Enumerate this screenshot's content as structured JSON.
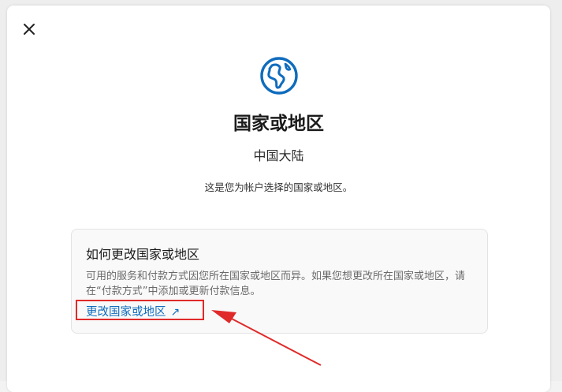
{
  "dialog": {
    "close_icon": "close-icon",
    "globe_icon": "globe-icon",
    "title": "国家或地区",
    "current_region": "中国大陆",
    "description": "这是您为帐户选择的国家或地区。"
  },
  "info_card": {
    "title": "如何更改国家或地区",
    "body": "可用的服务和付款方式因您所在国家或地区而异。如果您想更改所在国家或地区，请在“付款方式”中添加或更新付款信息。",
    "link_label": "更改国家或地区",
    "link_icon": "external-arrow-icon"
  },
  "colors": {
    "accent": "#0f6cbd",
    "annotation": "#e02a2a"
  }
}
